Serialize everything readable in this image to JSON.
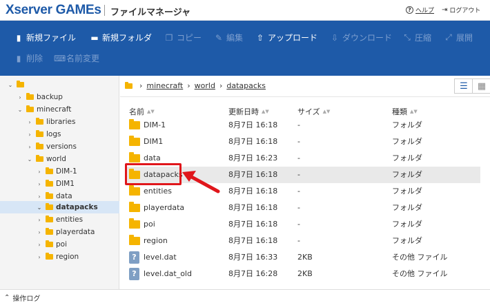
{
  "header": {
    "logo": "Xserver GAMEs",
    "title": "ファイルマネージャ",
    "help_label": "ヘルプ",
    "logout_label": "ログアウト"
  },
  "toolbar": {
    "new_file": "新規ファイル",
    "new_folder": "新規フォルダ",
    "copy": "コピー",
    "edit": "編集",
    "upload": "アップロード",
    "download": "ダウンロード",
    "compress": "圧縮",
    "extract": "展開",
    "delete": "削除",
    "rename": "名前変更"
  },
  "tree": [
    {
      "label": "",
      "expanded": true
    },
    {
      "label": "backup",
      "expanded": false
    },
    {
      "label": "minecraft",
      "expanded": true
    },
    {
      "label": "libraries",
      "expanded": false
    },
    {
      "label": "logs",
      "expanded": false
    },
    {
      "label": "versions",
      "expanded": false
    },
    {
      "label": "world",
      "expanded": true
    },
    {
      "label": "DIM-1",
      "expanded": false
    },
    {
      "label": "DIM1",
      "expanded": false
    },
    {
      "label": "data",
      "expanded": false
    },
    {
      "label": "datapacks",
      "expanded": false,
      "selected": true
    },
    {
      "label": "entities",
      "expanded": false
    },
    {
      "label": "playerdata",
      "expanded": false
    },
    {
      "label": "poi",
      "expanded": false
    },
    {
      "label": "region",
      "expanded": false
    }
  ],
  "breadcrumb": [
    "minecraft",
    "world",
    "datapacks"
  ],
  "columns": {
    "name": "名前",
    "modified": "更新日時",
    "size": "サイズ",
    "type": "種類"
  },
  "files": [
    {
      "name": "DIM-1",
      "modified": "8月7日 16:18",
      "size": "-",
      "type": "フォルダ",
      "kind": "folder"
    },
    {
      "name": "DIM1",
      "modified": "8月7日 16:18",
      "size": "-",
      "type": "フォルダ",
      "kind": "folder"
    },
    {
      "name": "data",
      "modified": "8月7日 16:23",
      "size": "-",
      "type": "フォルダ",
      "kind": "folder"
    },
    {
      "name": "datapacks",
      "modified": "8月7日 16:18",
      "size": "-",
      "type": "フォルダ",
      "kind": "folder",
      "highlighted": true
    },
    {
      "name": "entities",
      "modified": "8月7日 16:18",
      "size": "-",
      "type": "フォルダ",
      "kind": "folder"
    },
    {
      "name": "playerdata",
      "modified": "8月7日 16:18",
      "size": "-",
      "type": "フォルダ",
      "kind": "folder"
    },
    {
      "name": "poi",
      "modified": "8月7日 16:18",
      "size": "-",
      "type": "フォルダ",
      "kind": "folder"
    },
    {
      "name": "region",
      "modified": "8月7日 16:18",
      "size": "-",
      "type": "フォルダ",
      "kind": "folder"
    },
    {
      "name": "level.dat",
      "modified": "8月7日 16:33",
      "size": "2KB",
      "type": "その他 ファイル",
      "kind": "file"
    },
    {
      "name": "level.dat_old",
      "modified": "8月7日 16:28",
      "size": "2KB",
      "type": "その他 ファイル",
      "kind": "file"
    }
  ],
  "footer": {
    "log_label": "操作ログ"
  },
  "colors": {
    "brand": "#1e5aa8",
    "folder": "#f5b400",
    "callout": "#e0161b",
    "selected_tree": "#d7e6f6"
  }
}
